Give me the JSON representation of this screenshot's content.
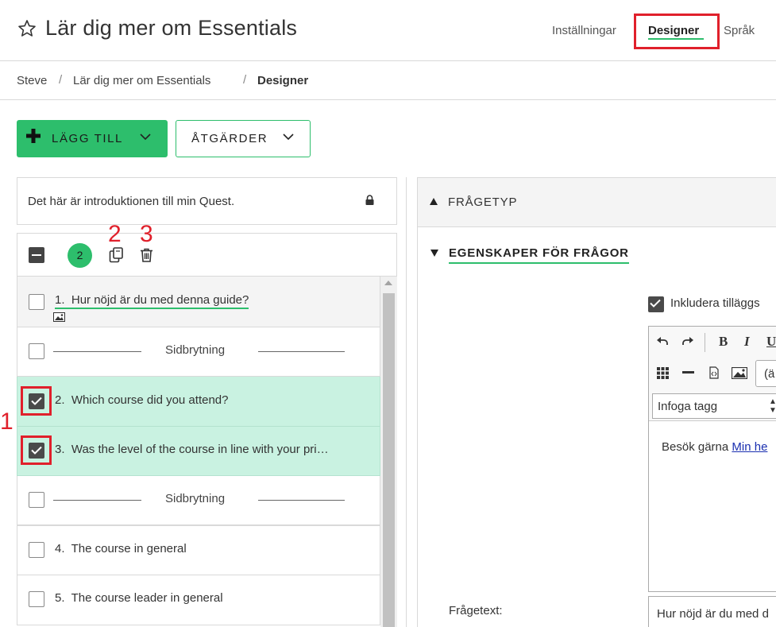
{
  "header": {
    "title": "Lär dig mer om Essentials",
    "nav": {
      "settings": "Inställningar",
      "designer": "Designer",
      "language": "Språk"
    }
  },
  "breadcrumb": [
    "Steve",
    "Lär dig mer om Essentials",
    "Designer"
  ],
  "toolbar": {
    "add_label": "LÄGG TILL",
    "actions_label": "ÅTGÄRDER"
  },
  "intro": {
    "text": "Det här är introduktionen till min Quest."
  },
  "selection": {
    "count": "2"
  },
  "annotations": {
    "one": "1",
    "two": "2",
    "three": "3"
  },
  "questions": [
    {
      "number": "1.",
      "text": "Hur nöjd är du med denna guide?",
      "checked": false
    },
    {
      "type": "page-break",
      "text": "Sidbrytning"
    },
    {
      "number": "2.",
      "text": "Which course did you attend?",
      "checked": true
    },
    {
      "number": "3.",
      "text": "Was the level of the course in line with your pri…",
      "checked": true
    },
    {
      "type": "page-break",
      "text": "Sidbrytning"
    },
    {
      "number": "4.",
      "text": "The course in general",
      "checked": false
    },
    {
      "number": "5.",
      "text": "The course leader in general",
      "checked": false
    }
  ],
  "right_panel": {
    "question_type_label": "FRÅGETYP",
    "properties_label": "EGENSKAPER FÖR FRÅGOR",
    "include_label": "Inkludera tilläggs",
    "editor": {
      "bold": "B",
      "italic": "I",
      "underline": "U",
      "format_value": "(ä",
      "tag_placeholder": "Infoga tagg",
      "content_prefix": "Besök gärna ",
      "content_link": "Min he"
    },
    "question_text_label": "Frågetext:",
    "question_text_value": "Hur nöjd är du med d"
  },
  "colors": {
    "accent": "#2dbe6c",
    "selected_row": "#c9f2e1",
    "annotation": "#e0202b"
  }
}
